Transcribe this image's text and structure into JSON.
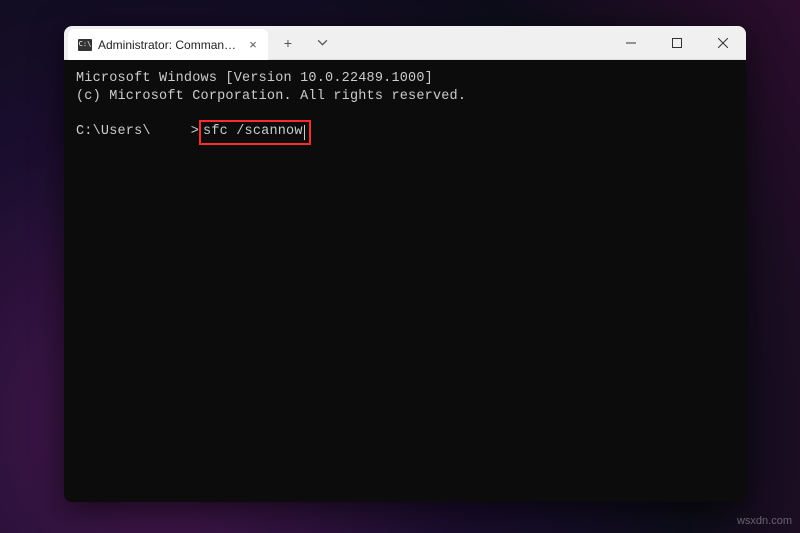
{
  "titlebar": {
    "tab_icon_text": "C:\\",
    "tab_title": "Administrator: Command Prompt",
    "tab_close": "×",
    "new_tab": "+",
    "dropdown": "⌄"
  },
  "window_controls": {
    "minimize": "—",
    "maximize": "▢",
    "close": "×"
  },
  "terminal": {
    "header_line1": "Microsoft Windows [Version 10.0.22489.1000]",
    "header_line2": "(c) Microsoft Corporation. All rights reserved.",
    "prompt_prefix": "C:\\Users\\",
    "prompt_suffix": ">",
    "command": "sfc /scannow"
  },
  "watermark": "wsxdn.com"
}
